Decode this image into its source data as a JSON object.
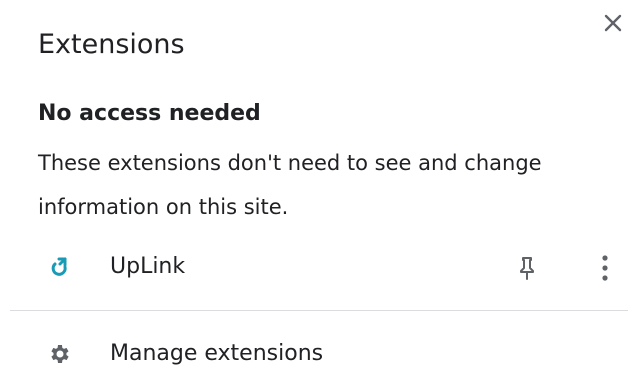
{
  "header": {
    "title": "Extensions",
    "close_icon": "close-icon"
  },
  "section": {
    "heading": "No access needed",
    "description": "These extensions don't need to see and change information on this site."
  },
  "extensions": [
    {
      "name": "UpLink",
      "icon": "uplink-icon",
      "icon_color": "#1a9bb5",
      "pin_icon": "pin-icon",
      "more_icon": "more-vertical-icon"
    }
  ],
  "footer": {
    "manage_label": "Manage extensions",
    "manage_icon": "gear-icon"
  },
  "colors": {
    "text": "#202124",
    "icon": "#5f6368",
    "divider": "#dadce0",
    "accent": "#1a9bb5"
  }
}
